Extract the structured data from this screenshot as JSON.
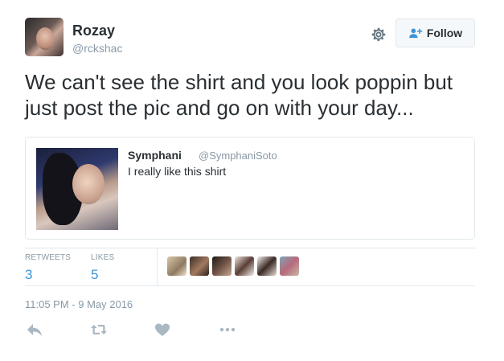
{
  "author": {
    "name": "Rozay",
    "handle": "@rckshac",
    "avatar_icon": "user-avatar"
  },
  "header": {
    "settings_icon": "gear-icon",
    "follow_label": "Follow",
    "follow_icon": "follow-person-plus-icon"
  },
  "tweet": {
    "text": "We can't see the shirt and you look poppin but just post the pic and go on with your day..."
  },
  "quoted": {
    "name": "Symphani",
    "handle": "@SymphaniSoto",
    "text": "I really like this shirt"
  },
  "stats": {
    "retweets_label": "RETWEETS",
    "retweets_count": "3",
    "likes_label": "LIKES",
    "likes_count": "5",
    "liker_avatar_count": 6
  },
  "timestamp": "11:05 PM - 9 May 2016",
  "actions": [
    "reply-icon",
    "retweet-icon",
    "like-icon",
    "more-icon"
  ],
  "colors": {
    "text": "#292f33",
    "muted": "#8899a6",
    "link_blue": "#3b94d9",
    "border": "#e1e8ed",
    "icon_gray": "#aab8c2"
  }
}
